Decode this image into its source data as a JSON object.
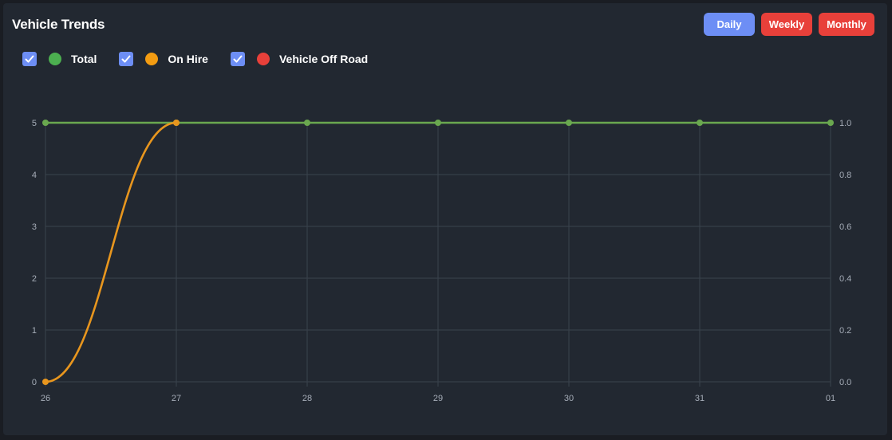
{
  "header": {
    "title": "Vehicle Trends",
    "buttons": {
      "daily": "Daily",
      "weekly": "Weekly",
      "monthly": "Monthly"
    }
  },
  "legend": [
    {
      "label": "Total",
      "color": "#4caf50",
      "checked": true
    },
    {
      "label": "On Hire",
      "color": "#f39c12",
      "checked": true
    },
    {
      "label": "Vehicle Off Road",
      "color": "#e8403a",
      "checked": true
    }
  ],
  "colors": {
    "background": "#222831",
    "accent": "#6d8ef5",
    "danger": "#e8403a",
    "grid": "#3a434d"
  },
  "chart_data": {
    "type": "line",
    "categories": [
      "26",
      "27",
      "28",
      "29",
      "30",
      "31",
      "01"
    ],
    "series": [
      {
        "name": "Total",
        "color": "#6aa84f",
        "values": [
          5,
          5,
          5,
          5,
          5,
          5,
          5
        ],
        "axis": "left"
      },
      {
        "name": "On Hire",
        "color": "#e8961e",
        "values": [
          0,
          5
        ],
        "axis": "left"
      }
    ],
    "ylim_left": [
      0,
      5
    ],
    "yticks_left": [
      "0",
      "1",
      "2",
      "3",
      "4",
      "5"
    ],
    "ylim_right": [
      0,
      1
    ],
    "yticks_right": [
      "0.0",
      "0.2",
      "0.4",
      "0.6",
      "0.8",
      "1.0"
    ],
    "grid": true,
    "legend_position": "top-left"
  }
}
